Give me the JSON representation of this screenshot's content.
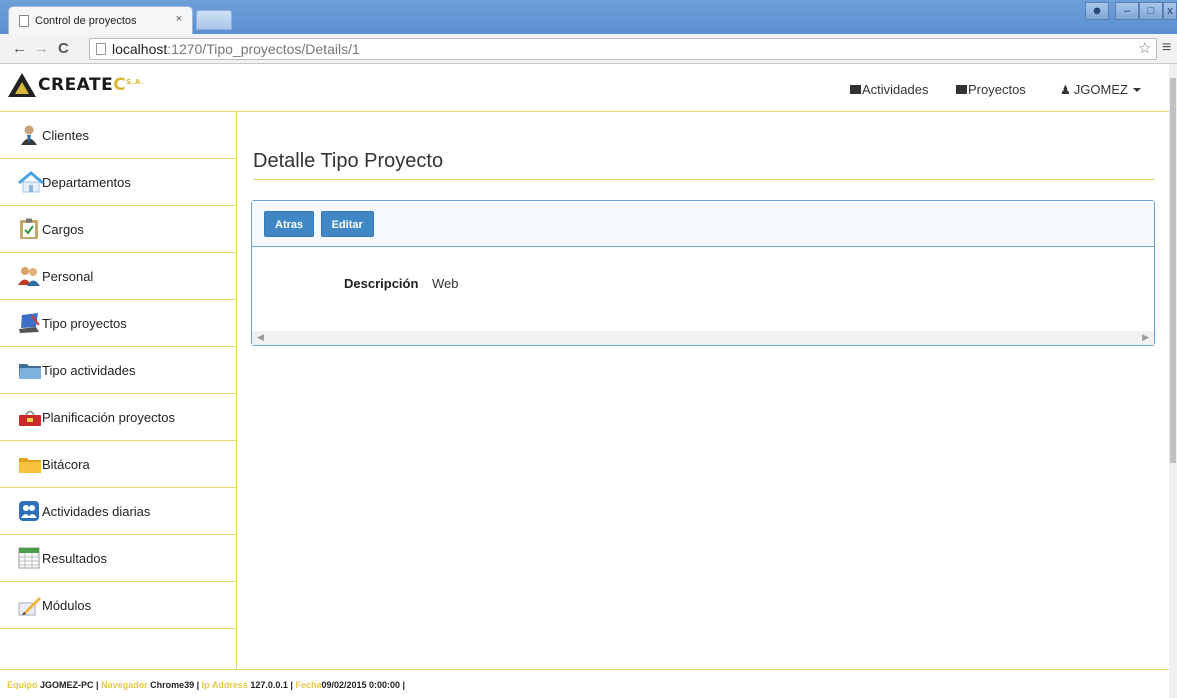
{
  "browser": {
    "tab_title": "Control de proyectos",
    "tab_close": "×",
    "url_host": "localhost",
    "url_rest": ":1270/Tipo_proyectos/Details/1"
  },
  "navbar": {
    "brand_main": "CREATE",
    "brand_accent": "C",
    "brand_suffix": "S.A.",
    "links": {
      "actividades": "Actividades",
      "proyectos": "Proyectos",
      "user": "JGOMEZ"
    }
  },
  "sidebar": {
    "items": [
      {
        "label": "Clientes",
        "icon": "client-icon"
      },
      {
        "label": "Departamentos",
        "icon": "house-icon"
      },
      {
        "label": "Cargos",
        "icon": "clipboard-icon"
      },
      {
        "label": "Personal",
        "icon": "people-icon"
      },
      {
        "label": "Tipo proyectos",
        "icon": "laptop-icon"
      },
      {
        "label": "Tipo actividades",
        "icon": "folder-icon"
      },
      {
        "label": "Planificación proyectos",
        "icon": "toolbox-icon"
      },
      {
        "label": "Bitácora",
        "icon": "folder-yellow-icon"
      },
      {
        "label": "Actividades diarias",
        "icon": "users-icon"
      },
      {
        "label": "Resultados",
        "icon": "spreadsheet-icon"
      },
      {
        "label": "Módulos",
        "icon": "pencil-icon"
      }
    ]
  },
  "main": {
    "title": "Detalle Tipo Proyecto",
    "buttons": {
      "back": "Atras",
      "edit": "Editar"
    },
    "field_label": "Descripción",
    "field_value": "Web"
  },
  "footer": {
    "equipo_label": "Equipo",
    "equipo_value": "JGOMEZ-PC |",
    "navegador_label": "Navegador",
    "navegador_value": "Chrome39 |",
    "ip_label": "Ip Address",
    "ip_value": "127.0.0.1 |",
    "fecha_label": "Fecha",
    "fecha_value": "09/02/2015 0:00:00 |"
  }
}
